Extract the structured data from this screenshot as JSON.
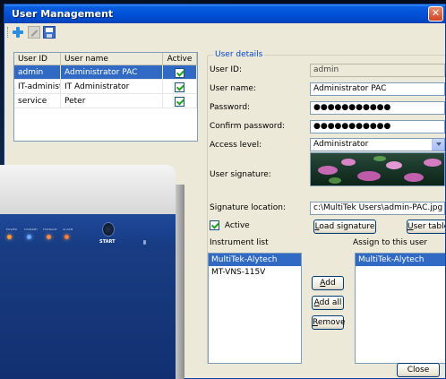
{
  "window": {
    "title": "User Management",
    "close_glyph": "✕"
  },
  "toolbar": {
    "items": [
      "add-user-icon",
      "edit-user-icon",
      "save-icon"
    ]
  },
  "user_table": {
    "columns": [
      "User ID",
      "User name",
      "Active"
    ],
    "rows": [
      {
        "id": "admin",
        "name": "Administrator PAC",
        "active": true,
        "selected": true
      },
      {
        "id": "IT-administ...",
        "name": "IT Administrator",
        "active": true,
        "selected": false
      },
      {
        "id": "service",
        "name": "Peter",
        "active": true,
        "selected": false
      }
    ]
  },
  "device": {
    "leds": [
      "POWER",
      "STANDBY",
      "FURNACE",
      "ALARM"
    ],
    "start_label": "START"
  },
  "details": {
    "legend": "User details",
    "user_id_label": "User ID:",
    "user_id_value": "admin",
    "user_name_label": "User name:",
    "user_name_value": "Administrator PAC",
    "password_label": "Password:",
    "password_value": "●●●●●●●●●●●",
    "confirm_label": "Confirm password:",
    "confirm_value": "●●●●●●●●●●●",
    "access_label": "Access level:",
    "access_value": "Administrator",
    "signature_label": "User signature:",
    "sig_location_label": "Signature location:",
    "sig_location_value": "c:\\MultiTek Users\\admin-PAC.jpg",
    "active_label": "Active",
    "load_sig_button": {
      "u": "L",
      "rest": "oad signature"
    },
    "user_table_button": {
      "u": "U",
      "rest": "ser table"
    },
    "instrument_list_label": "Instrument list",
    "assign_label": "Assign to this user",
    "instruments": [
      "MultiTek-Alytech",
      "MT-VNS-115V"
    ],
    "assigned": [
      "MultiTek-Alytech"
    ],
    "add_button": {
      "u": "A",
      "rest": "dd"
    },
    "add_all_button": {
      "u": "A",
      "rest": "dd all"
    },
    "remove_button": {
      "u": "R",
      "rest": "emove"
    }
  },
  "footer": {
    "close_button": "Close"
  }
}
